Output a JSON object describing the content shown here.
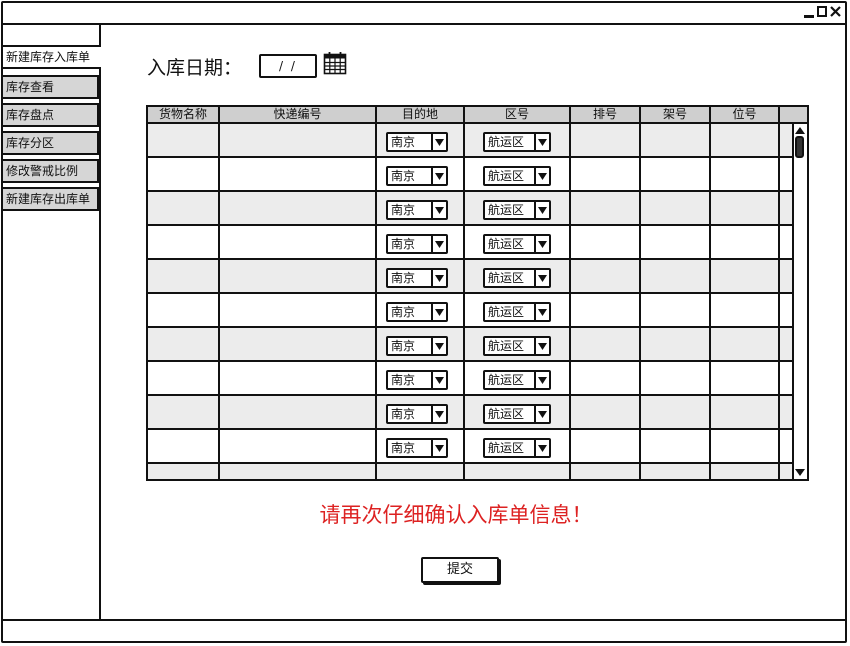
{
  "window": {
    "controls": [
      "minimize",
      "restore",
      "close"
    ]
  },
  "sidebar": {
    "items": [
      {
        "label": "新建库存入库单",
        "active": true
      },
      {
        "label": "库存查看",
        "active": false
      },
      {
        "label": "库存盘点",
        "active": false
      },
      {
        "label": "库存分区",
        "active": false
      },
      {
        "label": "修改警戒比例",
        "active": false
      },
      {
        "label": "新建库存出库单",
        "active": false
      }
    ]
  },
  "form": {
    "date_label": "入库日期：",
    "date_value": "/ /",
    "calendar_icon": "calendar-icon"
  },
  "table": {
    "columns": [
      "货物名称",
      "快递编号",
      "目的地",
      "区号",
      "排号",
      "架号",
      "位号"
    ],
    "rows": [
      {
        "destination": "南京",
        "zone": "航运区"
      },
      {
        "destination": "南京",
        "zone": "航运区"
      },
      {
        "destination": "南京",
        "zone": "航运区"
      },
      {
        "destination": "南京",
        "zone": "航运区"
      },
      {
        "destination": "南京",
        "zone": "航运区"
      },
      {
        "destination": "南京",
        "zone": "航运区"
      },
      {
        "destination": "南京",
        "zone": "航运区"
      },
      {
        "destination": "南京",
        "zone": "航运区"
      },
      {
        "destination": "南京",
        "zone": "航运区"
      },
      {
        "destination": "南京",
        "zone": "航运区"
      }
    ]
  },
  "warning": {
    "text": "请再次仔细确认入库单信息！",
    "color": "#dd2222"
  },
  "submit": {
    "label": "提交"
  }
}
